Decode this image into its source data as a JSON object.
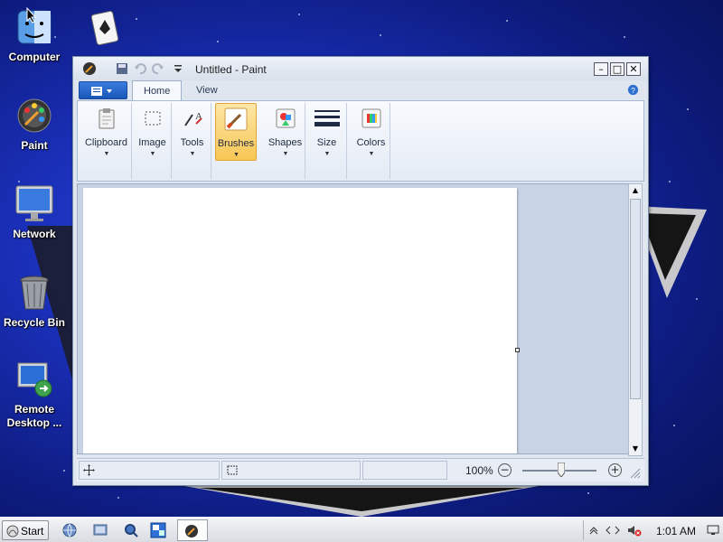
{
  "desktop": {
    "icons": [
      {
        "name": "Computer"
      },
      {
        "name": "Paint"
      },
      {
        "name": "Network"
      },
      {
        "name": "Recycle Bin"
      },
      {
        "name": "Remote Desktop ..."
      }
    ]
  },
  "window": {
    "title": "Untitled - Paint",
    "controls": {
      "minimize": "–",
      "maximize": "□",
      "close": "✕"
    }
  },
  "ribbon": {
    "tabs": [
      "Home",
      "View"
    ],
    "groups": [
      {
        "label": "Clipboard",
        "icon": "clipboard-icon"
      },
      {
        "label": "Image",
        "icon": "select-rectangle-icon"
      },
      {
        "label": "Tools",
        "icon": "tools-icon"
      },
      {
        "label": "Brushes",
        "icon": "brush-icon",
        "active": true
      },
      {
        "label": "Shapes",
        "icon": "shapes-icon"
      },
      {
        "label": "Size",
        "icon": "line-size-icon"
      },
      {
        "label": "Colors",
        "icon": "color-palette-icon"
      }
    ]
  },
  "status": {
    "zoom": "100%",
    "zoom_minus": "−",
    "zoom_plus": "+"
  },
  "taskbar": {
    "start_label": "Start",
    "clock": "1:01 AM"
  }
}
